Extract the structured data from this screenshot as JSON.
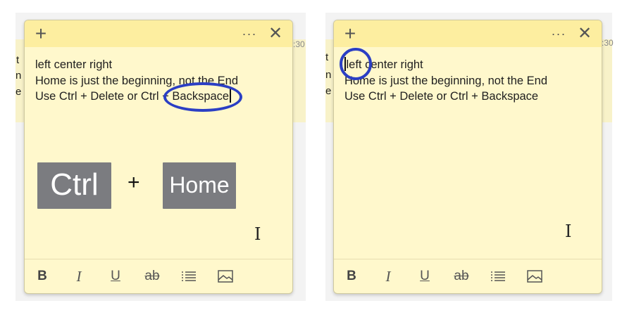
{
  "colors": {
    "note_body": "#fff8cc",
    "note_titlebar": "#fdeea0",
    "highlight": "#2b3fc4",
    "key_bg": "#7b7c80"
  },
  "background": {
    "left_edge_text": [
      "t",
      "n",
      "e"
    ],
    "time_fragment": ":30"
  },
  "note": {
    "titlebar": {
      "new_note_glyph": "+",
      "menu_glyph": "···",
      "close_glyph": "✕"
    },
    "lines_left": [
      "left center right",
      "Home is just the beginning, not the End",
      "Use Ctrl + Delete or Ctrl + "
    ],
    "highlight_word_left": "Backspace",
    "highlight_word_right": "left",
    "rest_line1_right": " center right",
    "lines_right": [
      "Home is just the beginning, not the End",
      "Use Ctrl + Delete or Ctrl + Backspace"
    ],
    "toolbar": {
      "bold": "B",
      "italic": "I",
      "underline": "U",
      "strike": "ab",
      "list_icon": "list-icon",
      "image_icon": "image-icon"
    }
  },
  "keyboard": {
    "key1": "Ctrl",
    "plus": "+",
    "key2": "Home"
  },
  "cursor_glyph": "I"
}
